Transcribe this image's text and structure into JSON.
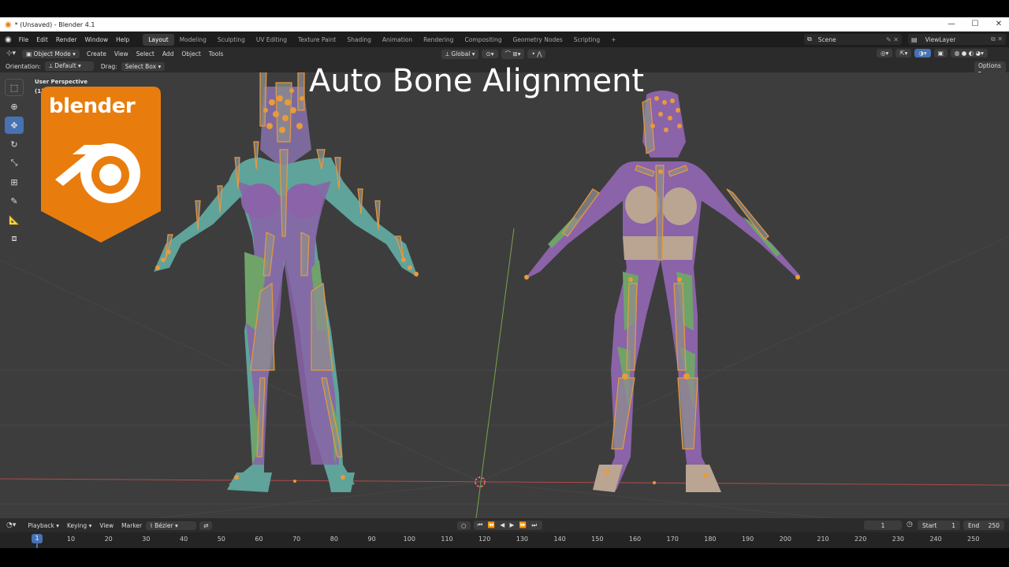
{
  "window": {
    "title": "* (Unsaved) - Blender 4.1",
    "minimize": "—",
    "maximize": "☐",
    "close": "✕"
  },
  "menu": {
    "items": [
      "File",
      "Edit",
      "Render",
      "Window",
      "Help"
    ]
  },
  "workspaces": [
    "Layout",
    "Modeling",
    "Sculpting",
    "UV Editing",
    "Texture Paint",
    "Shading",
    "Animation",
    "Rendering",
    "Compositing",
    "Geometry Nodes",
    "Scripting"
  ],
  "workspace_add": "+",
  "scene": {
    "label": "Scene",
    "viewlayer": "ViewLayer"
  },
  "header": {
    "mode": "Object Mode",
    "menus": [
      "Create",
      "View",
      "Select",
      "Add",
      "Object",
      "Tools"
    ],
    "transform_orientation": "Global"
  },
  "header2": {
    "orientation_label": "Orientation:",
    "orientation_value": "Default",
    "drag_label": "Drag:",
    "drag_value": "Select Box",
    "options": "Options"
  },
  "viewport": {
    "perspective_label": "User Perspective",
    "collection_label": "(1)",
    "overlay_title": "Auto Bone Alignment",
    "logo_text": "blender"
  },
  "timeline": {
    "menus": [
      "Playback",
      "Keying",
      "View",
      "Marker"
    ],
    "interpolation": "Bézier",
    "current_frame": "1",
    "start_label": "Start",
    "start_value": "1",
    "end_label": "End",
    "end_value": "250",
    "ruler_current": "1",
    "ruler_ticks": [
      "10",
      "20",
      "30",
      "40",
      "50",
      "60",
      "70",
      "80",
      "90",
      "100",
      "110",
      "120",
      "130",
      "140",
      "150",
      "160",
      "170",
      "180",
      "190",
      "200",
      "210",
      "220",
      "230",
      "240",
      "250"
    ]
  },
  "colors": {
    "viewport_bg": "#3d3d3d",
    "accent": "#4772b3",
    "bone": "#e89a3c",
    "blender_orange": "#e87d0d",
    "skin_teal": "#5fa39a",
    "skin_purple": "#8a63a8",
    "skin_green": "#6fa36a",
    "skin_beige": "#b9a592"
  }
}
